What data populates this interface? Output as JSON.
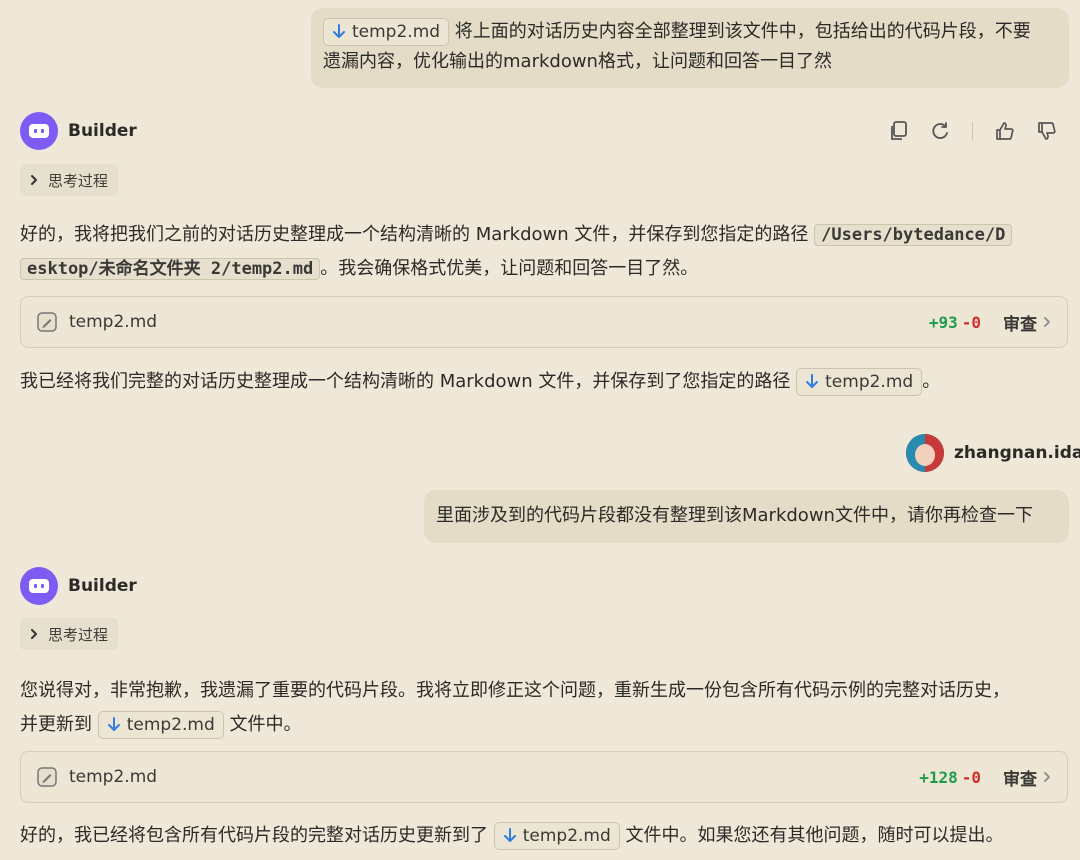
{
  "conversation": {
    "user_msg_1": {
      "file_chip": "temp2.md",
      "text": "将上面的对话历史内容全部整理到该文件中，包括给出的代码片段，不要遗漏内容，优化输出的markdown格式，让问题和回答一目了然",
      "line1": "将上面的对话历史内容全部整理到该文件中，包括给出的代码片段，不要",
      "line2": "遗漏内容，优化输出的markdown格式，让问题和回答一目了然"
    },
    "assistant_1": {
      "name": "Builder",
      "think_label": "思考过程",
      "para1_a": "好的，我将把我们之前的对话历史整理成一个结构清晰的 Markdown 文件，并保存到您指定的路径",
      "path_part1": "/Users/bytedance/D",
      "path_part2": "esktop/未命名文件夹 2/temp2.md",
      "para1_b": "。我会确保格式优美，让问题和回答一目了然。",
      "file_card": {
        "name": "temp2.md",
        "added": "+93",
        "removed": "-0",
        "review": "审查"
      },
      "para2": "我已经将我们完整的对话历史整理成一个结构清晰的 Markdown 文件，并保存到了您指定的路径",
      "para2_chip": "temp2.md",
      "para2_end": "。"
    },
    "user_2": {
      "username": "zhangnan.ida",
      "text": "里面涉及到的代码片段都没有整理到该Markdown文件中，请你再检查一下"
    },
    "assistant_2": {
      "name": "Builder",
      "think_label": "思考过程",
      "para1_line1": "您说得对，非常抱歉，我遗漏了重要的代码片段。我将立即修正这个问题，重新生成一份包含所有代码示例的完整对话历史，",
      "para1_line2_a": "并更新到",
      "para1_chip": "temp2.md",
      "para1_line2_b": "文件中。",
      "file_card": {
        "name": "temp2.md",
        "added": "+128",
        "removed": "-0",
        "review": "审查"
      },
      "para2_a": "好的，我已经将包含所有代码片段的完整对话历史更新到了",
      "para2_chip": "temp2.md",
      "para2_b": "文件中。如果您还有其他问题，随时可以提出。"
    }
  },
  "icons": [
    "download-arrow-icon",
    "copy-icon",
    "refresh-icon",
    "thumbs-up-icon",
    "thumbs-down-icon",
    "chevron-right-icon",
    "attachment-icon",
    "bot-icon"
  ],
  "colors": {
    "background": "#efe8d8",
    "bubble": "#e4dcc7",
    "accent": "#7e5cf4",
    "added": "#1f9c4a",
    "removed": "#d0302e",
    "link_icon": "#2f7de1"
  }
}
